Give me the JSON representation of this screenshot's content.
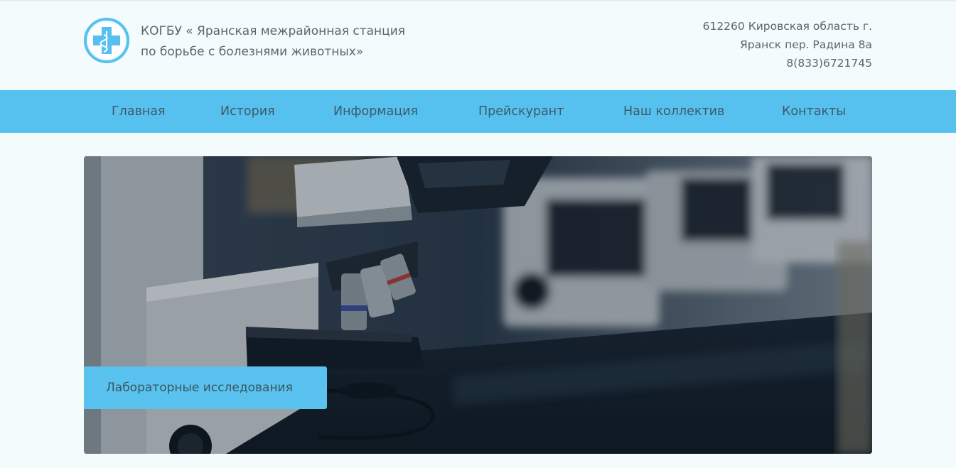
{
  "header": {
    "org_name_line1": "КОГБУ « Яранская межрайонная станция",
    "org_name_line2": "по борьбе с болезнями животных»",
    "address_line1": "612260 Кировская область г.",
    "address_line2": "Яранск пер. Радина 8а",
    "phone": "8(833)6721745",
    "logo_icon": "veterinary-cross-icon"
  },
  "nav": {
    "items": [
      {
        "label": "Главная"
      },
      {
        "label": "История"
      },
      {
        "label": "Информация"
      },
      {
        "label": "Прейскурант"
      },
      {
        "label": "Наш коллектив"
      },
      {
        "label": "Контакты"
      }
    ]
  },
  "slider": {
    "caption": "Лабораторные исследования",
    "image": "laboratory-microscopes-photo",
    "prev_icon": "chevron-left-icon",
    "next_icon": "chevron-right-icon"
  },
  "colors": {
    "accent": "#56c1ef",
    "background": "#f3fbfd",
    "text": "#59666d"
  }
}
